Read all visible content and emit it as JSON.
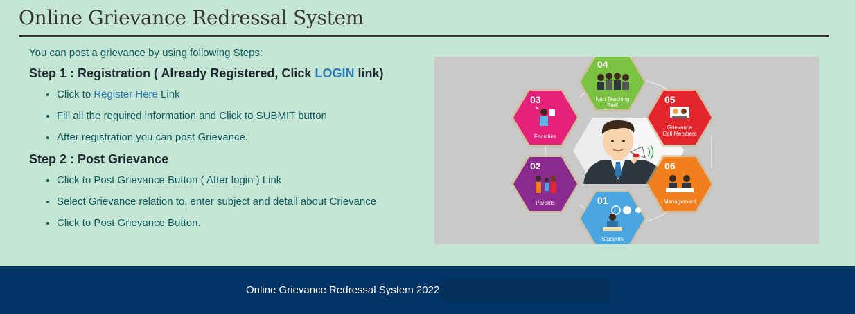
{
  "header": {
    "title": "Online Grievance Redressal System"
  },
  "intro": "You can post a grievance by using following Steps:",
  "step1": {
    "heading_prefix": "Step 1 : Registration ( Already Registered, Click ",
    "login_link": "LOGIN",
    "heading_suffix": " link)",
    "items": [
      {
        "prefix": "Click to ",
        "link": "Register Here",
        "suffix": " Link"
      },
      {
        "text": "Fill all the required information and Click to SUBMIT button"
      },
      {
        "text": "After registration you can post Grievance."
      }
    ]
  },
  "step2": {
    "heading": "Step 2 : Post Grievance",
    "items": [
      "Click to Post Grievance Button ( After login ) Link",
      "Select Grievance relation to, enter subject and detail about Crievance",
      "Click to Post Grievance Button."
    ]
  },
  "illustration": {
    "hexagons": [
      {
        "num": "04",
        "label1": "Non Teaching",
        "label2": "Staff",
        "color": "#7cc242"
      },
      {
        "num": "05",
        "label1": "Grievance",
        "label2": "Cell Members",
        "color": "#e3262d"
      },
      {
        "num": "06",
        "label1": "Management",
        "label2": "",
        "color": "#f07f1c"
      },
      {
        "num": "01",
        "label1": "Students",
        "label2": "",
        "color": "#49a6e0"
      },
      {
        "num": "02",
        "label1": "Parents",
        "label2": "",
        "color": "#8a2a8e"
      },
      {
        "num": "03",
        "label1": "Faculties",
        "label2": "",
        "color": "#e5217a"
      }
    ]
  },
  "footer": {
    "text": "Online Grievance Redressal System 2022 |"
  }
}
